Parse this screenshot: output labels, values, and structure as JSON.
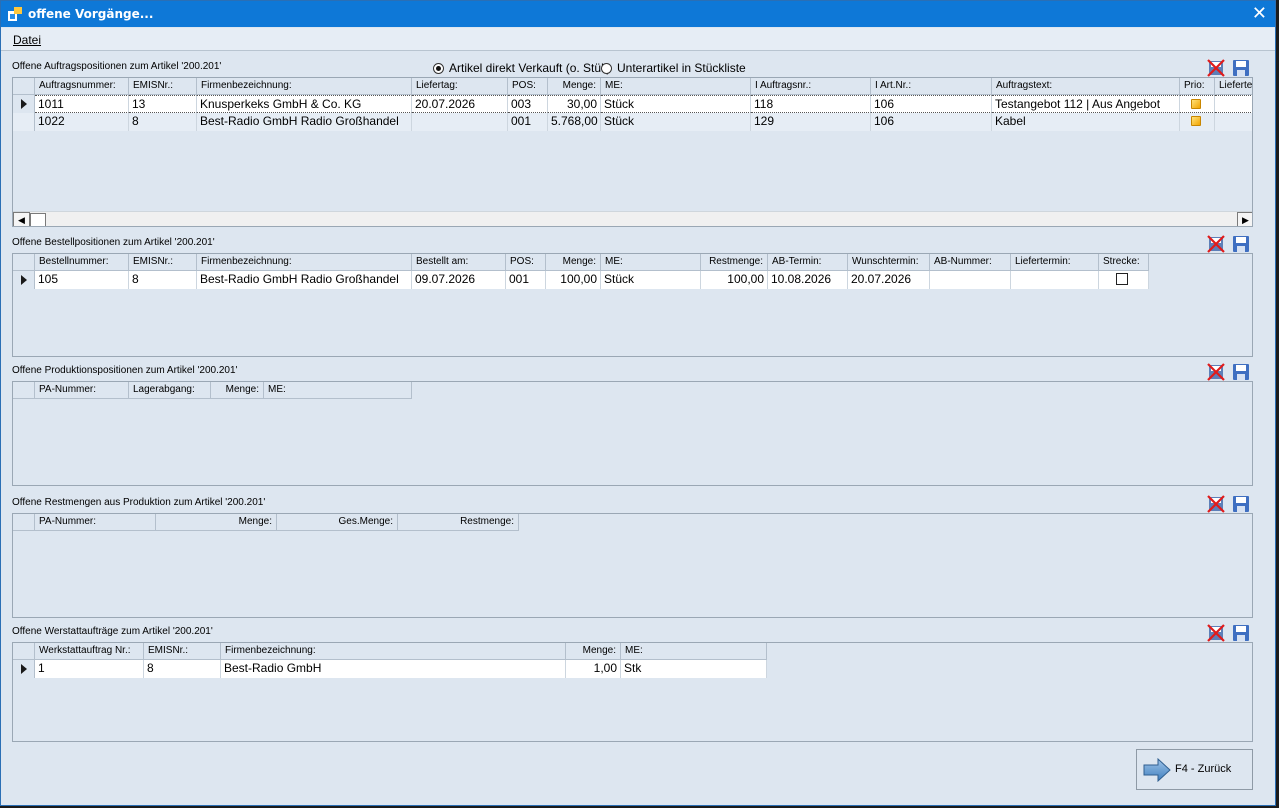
{
  "window": {
    "title": "offene Vorgänge..."
  },
  "menu": {
    "datei": "Datei"
  },
  "auftrag": {
    "caption": "Offene Auftragspositionen zum Artikel '200.201'",
    "radio1": "Artikel direkt Verkauft (o. Stüli)",
    "radio2": "Unterartikel in Stückliste",
    "headers": [
      "Auftragsnummer:",
      "EMISNr.:",
      "Firmenbezeichnung:",
      "Liefertag:",
      "POS:",
      "Menge:",
      "ME:",
      "I Auftragsnr.:",
      "I Art.Nr.:",
      "Auftragstext:",
      "Prio:",
      "Lieferte"
    ],
    "rows": [
      [
        "1011",
        "13",
        "Knusperkeks GmbH & Co. KG",
        "20.07.2026",
        "003",
        "30,00",
        "Stück",
        "118",
        "106",
        "Testangebot 112 | Aus Angebot"
      ],
      [
        "1022",
        "8",
        "Best-Radio GmbH Radio Großhandel",
        "",
        "001",
        "5.768,00",
        "Stück",
        "129",
        "106",
        "Kabel"
      ]
    ]
  },
  "bestell": {
    "caption": "Offene Bestellpositionen zum Artikel '200.201'",
    "headers": [
      "Bestellnummer:",
      "EMISNr.:",
      "Firmenbezeichnung:",
      "Bestellt am:",
      "POS:",
      "Menge:",
      "ME:",
      "Restmenge:",
      "AB-Termin:",
      "Wunschtermin:",
      "AB-Nummer:",
      "Liefertermin:",
      "Strecke:"
    ],
    "rows": [
      [
        "105",
        "8",
        "Best-Radio GmbH Radio Großhandel",
        "09.07.2026",
        "001",
        "100,00",
        "Stück",
        "100,00",
        "10.08.2026",
        "20.07.2026",
        "",
        ""
      ]
    ]
  },
  "produktion": {
    "caption": "Offene Produktionspositionen zum Artikel '200.201'",
    "headers": [
      "PA-Nummer:",
      "Lagerabgang:",
      "Menge:",
      "ME:"
    ]
  },
  "restmengen": {
    "caption": "Offene Restmengen aus Produktion zum Artikel '200.201'",
    "headers": [
      "PA-Nummer:",
      "Menge:",
      "Ges.Menge:",
      "Restmenge:"
    ]
  },
  "werkstatt": {
    "caption": "Offene Werstattaufträge zum Artikel '200.201'",
    "headers": [
      "Werkstattauftrag Nr.:",
      "EMISNr.:",
      "Firmenbezeichnung:",
      "Menge:",
      "ME:"
    ],
    "rows": [
      [
        "1",
        "8",
        "Best-Radio GmbH",
        "1,00",
        "Stk"
      ]
    ]
  },
  "button": {
    "back": "F4 - Zurück"
  }
}
